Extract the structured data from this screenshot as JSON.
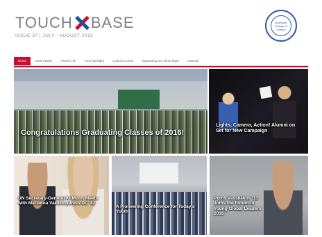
{
  "header": {
    "title_left": "TOUCH",
    "title_right": "BASE",
    "issue_line": "ISSUE 37 | JULY - AUGUST 2016",
    "seal_text": "American College of Greece"
  },
  "nav": {
    "items": [
      {
        "label": "Home"
      },
      {
        "label": "Alumni Base"
      },
      {
        "label": "Alumni Life"
      },
      {
        "label": "ACG Spotlight"
      },
      {
        "label": "Cultural Corner"
      },
      {
        "label": "Supporting our Alma Mater"
      },
      {
        "label": "Network"
      }
    ]
  },
  "tiles": {
    "graduation": {
      "caption": "Congratulations Graduating Classes of 2016!"
    },
    "campaign": {
      "caption": "Lights, Camera, Action! Alumni on Set for New Campaign"
    },
    "un": {
      "caption": "UN Secretary-General Ki-Moon Meets with Marianna Vardinoyannis DC '82"
    },
    "conference": {
      "caption": "A Pioneering Conference for Today's Youth"
    },
    "leaders": {
      "caption": "Pyros Vassilakos '13 Joins the Forum of Young Global Leaders 2016"
    }
  },
  "colors": {
    "accent_red": "#c8102e",
    "accent_blue": "#1f4e9c"
  }
}
